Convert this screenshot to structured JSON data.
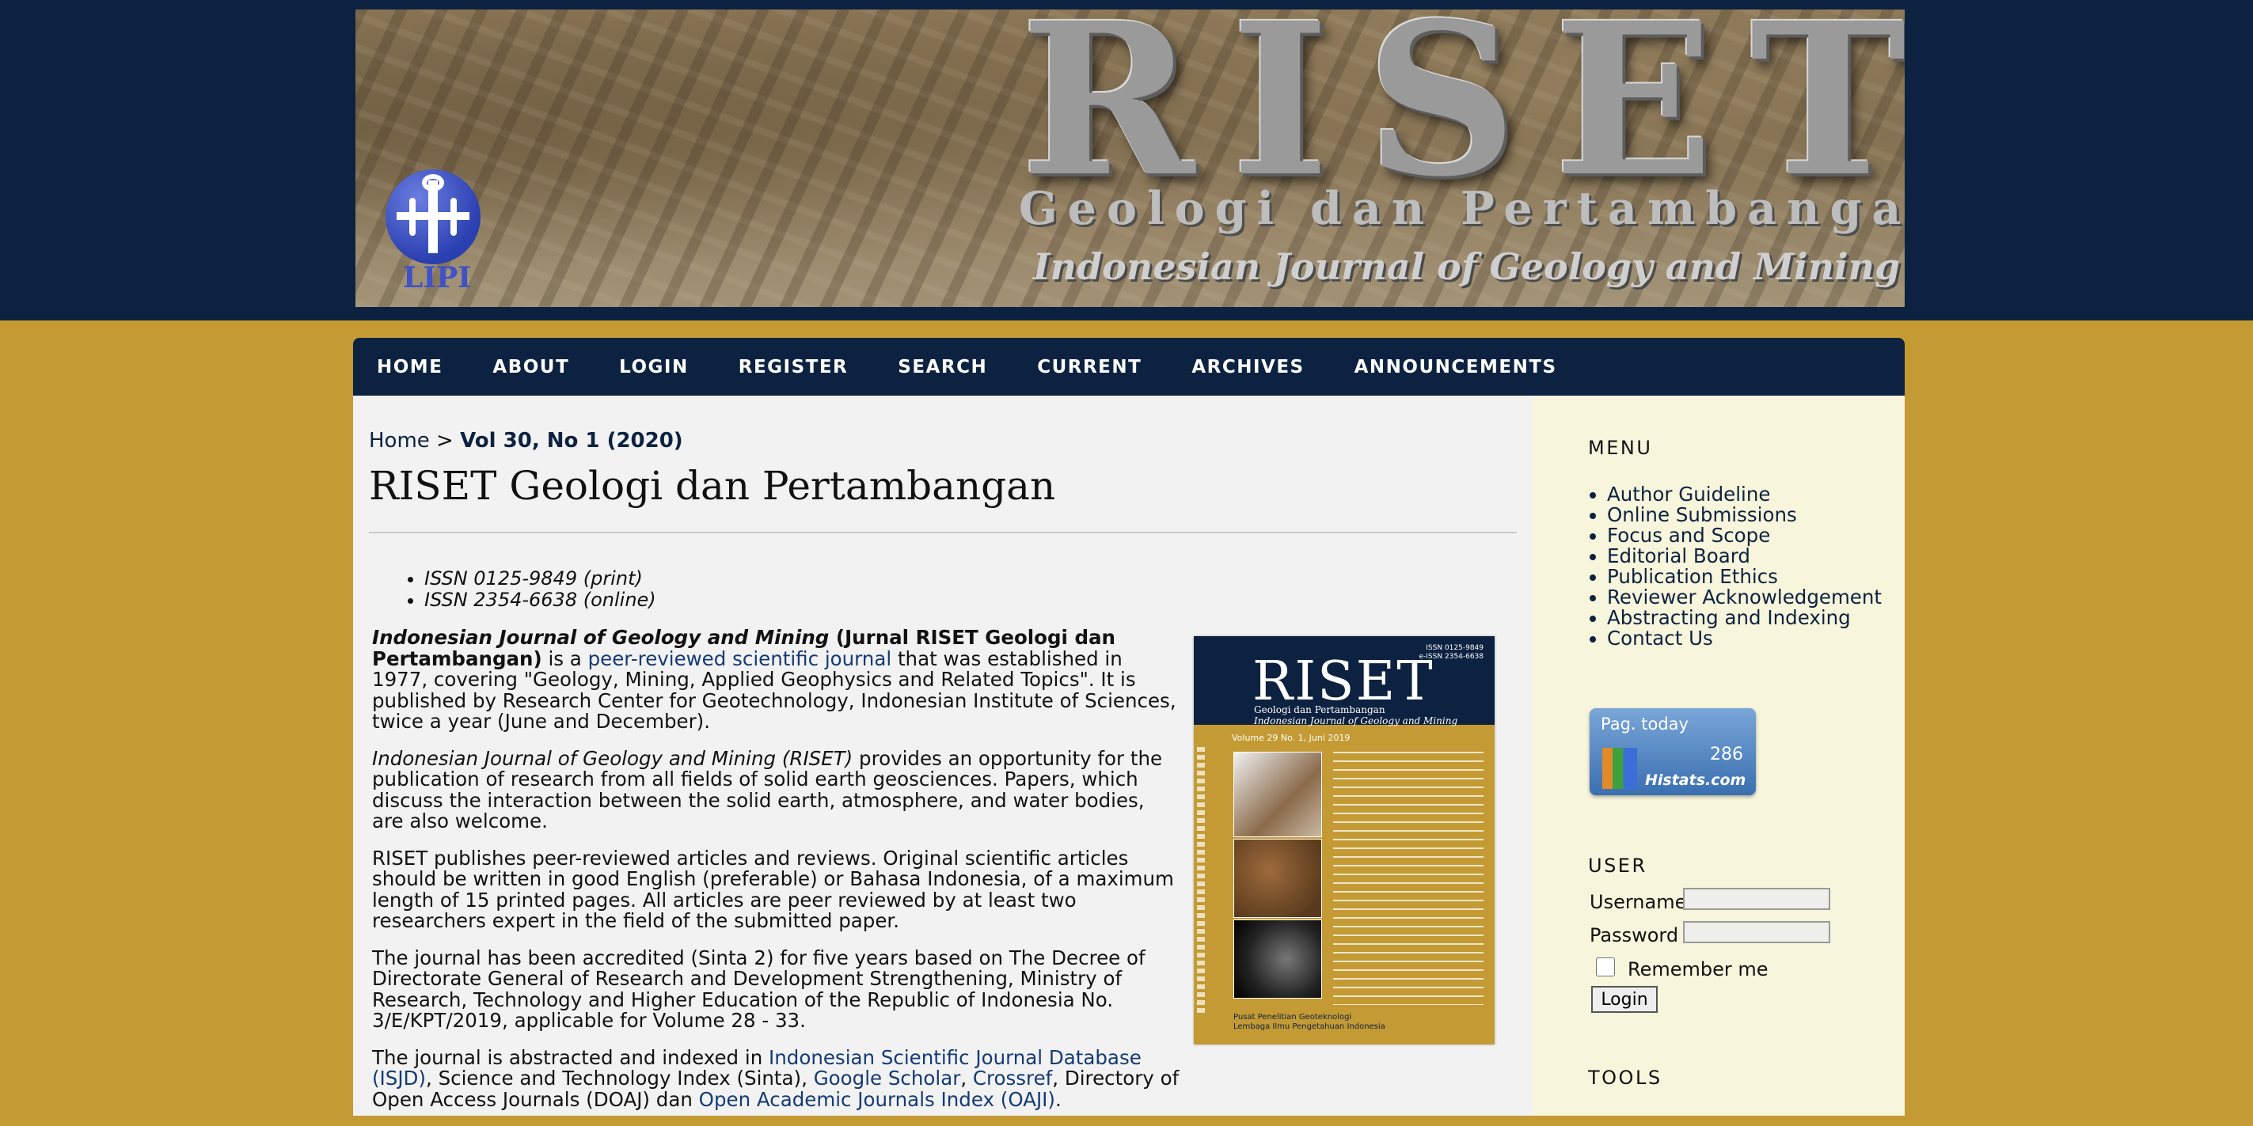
{
  "header": {
    "banner_title": "RISET",
    "banner_subtitle": "Geologi dan Pertambangan",
    "banner_tagline": "Indonesian Journal of Geology and Mining",
    "logo_text": "LIPI"
  },
  "nav": {
    "items": [
      "HOME",
      "ABOUT",
      "LOGIN",
      "REGISTER",
      "SEARCH",
      "CURRENT",
      "ARCHIVES",
      "ANNOUNCEMENTS"
    ]
  },
  "breadcrumb": {
    "home": "Home",
    "separator": ">",
    "current": "Vol 30, No 1 (2020)"
  },
  "page_title": "RISET Geologi dan Pertambangan",
  "issn": [
    "ISSN 0125-9849 (print)",
    "ISSN 2354-6638 (online)"
  ],
  "content": {
    "p1_bold_italic": "Indonesian Journal of Geology and Mining",
    "p1_bold": " (Jurnal RISET Geologi dan Pertambangan)",
    "p1_text1": " is a ",
    "p1_link": "peer-reviewed scientific journal",
    "p1_text2": " that was established in 1977, covering \"Geology, Mining, Applied Geophysics and Related Topics\".  It is published by Research Center for Geotechnology, Indonesian Institute of Sciences, twice a year (June and December).",
    "p2_italic": "Indonesian Journal of Geology and Mining (RISET)",
    "p2_text": " provides an opportunity for the publication of research from all fields of solid earth geosciences. Papers, which discuss the interaction between the solid earth, atmosphere, and water bodies, are also welcome.",
    "p3_text": "RISET publishes peer-reviewed articles and reviews. Original scientific articles should be written in good English (preferable) or Bahasa Indonesia, of a maximum length of 15 printed pages. All articles are peer reviewed by at least two researchers expert in the field of the submitted paper.",
    "p4_text": "The journal has been accredited (Sinta 2) for five years based on The Decree of Directorate General of Research and Development Strengthening, Ministry of Research, Technology and Higher Education of the Republic of Indonesia No. 3/E/KPT/2019, applicable for Volume 28 - 33.",
    "p5_text1": "The journal is abstracted and indexed in ",
    "p5_link1": "Indonesian Scientific Journal Database (ISJD)",
    "p5_text2": ", Science and Technology Index (Sinta), ",
    "p5_link2": "Google Scholar",
    "p5_text3": ", ",
    "p5_link3": "Crossref",
    "p5_text4": ", Directory of Open Access Journals (DOAJ) dan ",
    "p5_link4": "Open Academic Journals Index (OAJI)",
    "p5_text5": "."
  },
  "cover": {
    "logo": "RISET",
    "sub1": "Geologi dan Pertambangan",
    "sub2": "Indonesian Journal of Geology and Mining",
    "issn_print": "ISSN 0125-9849",
    "issn_online": "e-ISSN 2354-6638",
    "volume": "Volume 29  No. 1, Juni 2019",
    "publisher1": "Pusat Penelitian Geoteknologi",
    "publisher2": "Lembaga Ilmu Pengetahuan Indonesia"
  },
  "sidebar": {
    "menu_heading": "MENU",
    "menu_items": [
      "Author Guideline",
      "Online Submissions",
      "Focus and Scope",
      "Editorial Board",
      "Publication Ethics",
      "Reviewer Acknowledgement",
      "Abstracting and Indexing",
      "Contact Us"
    ],
    "histats_label": "Pag. today",
    "histats_count": "286",
    "histats_brand": "Histats.com",
    "user_heading": "USER",
    "username_label": "Username",
    "password_label": "Password",
    "remember_label": "Remember me",
    "login_button": "Login",
    "tools_heading": "TOOLS"
  },
  "colors": {
    "navy": "#0c2240",
    "gold": "#c49a34",
    "main_bg": "#f2f2f2",
    "sidebar_bg": "#f7f5db",
    "link": "#143a74"
  }
}
